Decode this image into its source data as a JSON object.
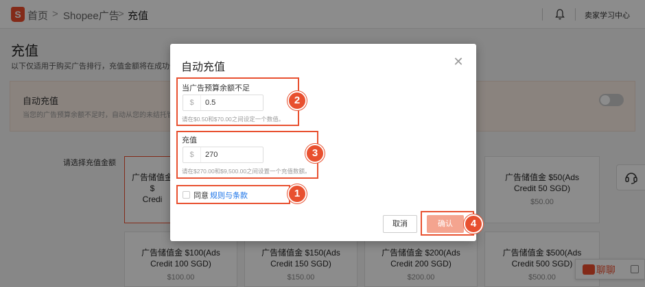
{
  "topbar": {
    "logo_text": "S",
    "crumbs": [
      "首页",
      "Shopee广告",
      "充值"
    ],
    "separator": ">",
    "learning_center": "卖家学习中心"
  },
  "page": {
    "title": "充值",
    "description": "以下仅适用于购买广告排行，充值金额将在成功付",
    "auto_recharge": {
      "title": "自动充值",
      "description": "当您的广告预算余额不足时，自动从您的未结托管余额",
      "toggle_on": false
    },
    "choose_label": "请选择充值金额",
    "cards": [
      {
        "name": "广告储值金 $",
        "name2": "Credi",
        "price": ""
      },
      {
        "name": "广告储值金 $50(Ads",
        "name2": "Credit 50 SGD)",
        "price": "$50.00"
      },
      {
        "name": "广告储值金 $100(Ads",
        "name2": "Credit 100 SGD)",
        "price": "$100.00"
      },
      {
        "name": "广告储值金 $150(Ads",
        "name2": "Credit 150 SGD)",
        "price": "$150.00"
      },
      {
        "name": "广告储值金 $200(Ads",
        "name2": "Credit 200 SGD)",
        "price": "$200.00"
      },
      {
        "name": "广告储值金 $500(Ads",
        "name2": "Credit 500 SGD)",
        "price": "$500.00"
      }
    ],
    "chat_label": "聊聊"
  },
  "modal": {
    "title": "自动充值",
    "close_symbol": "✕",
    "threshold": {
      "label": "当广告预算余额不足",
      "prefix": "$",
      "value": "0.5",
      "hint": "请在$0.50和$70.00之间设定一个数值。"
    },
    "recharge": {
      "label": "充值",
      "prefix": "$",
      "value": "270",
      "hint": "请在$270.00和$9,500.00之间设置一个充值数额。"
    },
    "agree_text": "同意",
    "terms_link": "规则与条款",
    "agree_checked": false,
    "cancel_label": "取消",
    "confirm_label": "确认"
  },
  "annotations": {
    "color": "#e8502f",
    "badges": [
      "1",
      "2",
      "3",
      "4"
    ]
  }
}
